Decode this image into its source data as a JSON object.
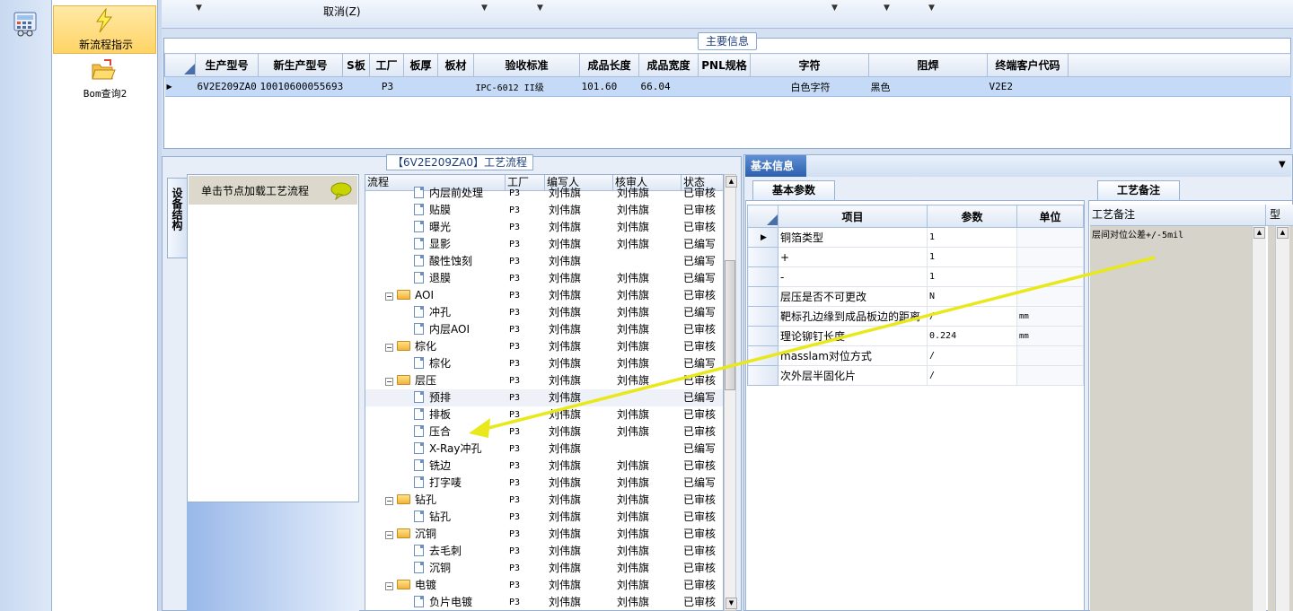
{
  "toolbar": {
    "cancel_label": "取消(Z)"
  },
  "nav": {
    "items": [
      {
        "label": "新流程指示",
        "icon": "lightning-icon"
      },
      {
        "label": "Bom查询2",
        "icon": "folder-open-icon"
      }
    ]
  },
  "main_info": {
    "title": "主要信息",
    "columns": [
      "生产型号",
      "新生产型号",
      "S板",
      "工厂",
      "板厚",
      "板材",
      "验收标准",
      "成品长度",
      "成品宽度",
      "PNL规格",
      "字符",
      "阻焊",
      "终端客户代码"
    ],
    "row": [
      "6V2E209ZA0",
      "10010600055693",
      "",
      "P3",
      "",
      "",
      "IPC-6012 II级",
      "101.60",
      "66.04",
      "",
      "白色字符",
      "黑色",
      "V2E2"
    ]
  },
  "process": {
    "title": "【6V2E209ZA0】工艺流程",
    "side_tab": "设备结构",
    "left_header": "单击节点加载工艺流程",
    "columns": [
      "流程",
      "工厂",
      "编写人",
      "核审人",
      "状态"
    ],
    "rows": [
      {
        "name": "内层前处理",
        "kind": "doc",
        "factory": "P3",
        "writer": "刘伟旗",
        "reviewer": "刘伟旗",
        "status": "已审核"
      },
      {
        "name": "贴膜",
        "kind": "doc",
        "factory": "P3",
        "writer": "刘伟旗",
        "reviewer": "刘伟旗",
        "status": "已审核"
      },
      {
        "name": "曝光",
        "kind": "doc",
        "factory": "P3",
        "writer": "刘伟旗",
        "reviewer": "刘伟旗",
        "status": "已审核"
      },
      {
        "name": "显影",
        "kind": "doc",
        "factory": "P3",
        "writer": "刘伟旗",
        "reviewer": "刘伟旗",
        "status": "已编写"
      },
      {
        "name": "酸性蚀刻",
        "kind": "doc",
        "factory": "P3",
        "writer": "刘伟旗",
        "reviewer": "",
        "status": "已编写"
      },
      {
        "name": "退膜",
        "kind": "doc",
        "factory": "P3",
        "writer": "刘伟旗",
        "reviewer": "刘伟旗",
        "status": "已编写"
      },
      {
        "name": "AOI",
        "kind": "folder",
        "factory": "P3",
        "writer": "刘伟旗",
        "reviewer": "刘伟旗",
        "status": "已审核"
      },
      {
        "name": "冲孔",
        "kind": "doc",
        "factory": "P3",
        "writer": "刘伟旗",
        "reviewer": "刘伟旗",
        "status": "已编写"
      },
      {
        "name": "内层AOI",
        "kind": "doc",
        "factory": "P3",
        "writer": "刘伟旗",
        "reviewer": "刘伟旗",
        "status": "已审核"
      },
      {
        "name": "棕化",
        "kind": "folder",
        "factory": "P3",
        "writer": "刘伟旗",
        "reviewer": "刘伟旗",
        "status": "已审核"
      },
      {
        "name": "棕化",
        "kind": "doc",
        "factory": "P3",
        "writer": "刘伟旗",
        "reviewer": "刘伟旗",
        "status": "已编写"
      },
      {
        "name": "层压",
        "kind": "folder",
        "factory": "P3",
        "writer": "刘伟旗",
        "reviewer": "刘伟旗",
        "status": "已审核"
      },
      {
        "name": "预排",
        "kind": "doc",
        "factory": "P3",
        "writer": "刘伟旗",
        "reviewer": "",
        "status": "已编写"
      },
      {
        "name": "排板",
        "kind": "doc",
        "factory": "P3",
        "writer": "刘伟旗",
        "reviewer": "刘伟旗",
        "status": "已审核"
      },
      {
        "name": "压合",
        "kind": "doc",
        "factory": "P3",
        "writer": "刘伟旗",
        "reviewer": "刘伟旗",
        "status": "已审核"
      },
      {
        "name": "X-Ray冲孔",
        "kind": "doc",
        "factory": "P3",
        "writer": "刘伟旗",
        "reviewer": "",
        "status": "已编写"
      },
      {
        "name": "铣边",
        "kind": "doc",
        "factory": "P3",
        "writer": "刘伟旗",
        "reviewer": "刘伟旗",
        "status": "已审核"
      },
      {
        "name": "打字唛",
        "kind": "doc",
        "factory": "P3",
        "writer": "刘伟旗",
        "reviewer": "刘伟旗",
        "status": "已编写"
      },
      {
        "name": "钻孔",
        "kind": "folder",
        "factory": "P3",
        "writer": "刘伟旗",
        "reviewer": "刘伟旗",
        "status": "已审核"
      },
      {
        "name": "钻孔",
        "kind": "doc",
        "factory": "P3",
        "writer": "刘伟旗",
        "reviewer": "刘伟旗",
        "status": "已审核"
      },
      {
        "name": "沉铜",
        "kind": "folder",
        "factory": "P3",
        "writer": "刘伟旗",
        "reviewer": "刘伟旗",
        "status": "已审核"
      },
      {
        "name": "去毛刺",
        "kind": "doc",
        "factory": "P3",
        "writer": "刘伟旗",
        "reviewer": "刘伟旗",
        "status": "已审核"
      },
      {
        "name": "沉铜",
        "kind": "doc",
        "factory": "P3",
        "writer": "刘伟旗",
        "reviewer": "刘伟旗",
        "status": "已审核"
      },
      {
        "name": "电镀",
        "kind": "folder",
        "factory": "P3",
        "writer": "刘伟旗",
        "reviewer": "刘伟旗",
        "status": "已审核"
      },
      {
        "name": "负片电镀",
        "kind": "doc",
        "factory": "P3",
        "writer": "刘伟旗",
        "reviewer": "刘伟旗",
        "status": "已审核"
      }
    ]
  },
  "basic_info": {
    "tab": "基本信息",
    "params_tab": "基本参数",
    "columns": [
      "项目",
      "参数",
      "单位"
    ],
    "rows": [
      {
        "item": "铜箔类型",
        "value": "1",
        "unit": ""
      },
      {
        "item": "+",
        "value": "1",
        "unit": ""
      },
      {
        "item": "-",
        "value": "1",
        "unit": ""
      },
      {
        "item": "层压是否不可更改",
        "value": "N",
        "unit": ""
      },
      {
        "item": "靶标孔边缘到成品板边的距离",
        "value": "/",
        "unit": "mm"
      },
      {
        "item": "理论铆钉长度",
        "value": "0.224",
        "unit": "mm"
      },
      {
        "item": "masslam对位方式",
        "value": "/",
        "unit": ""
      },
      {
        "item": "次外层半固化片",
        "value": "/",
        "unit": ""
      }
    ]
  },
  "remarks": {
    "tab": "工艺备注",
    "columns": [
      "工艺备注",
      "型"
    ],
    "text": "层间对位公差+/-5mil"
  },
  "colors": {
    "accent": "#2c5fae",
    "highlight": "#ffd465",
    "annotation_arrow": "#f2f21a"
  }
}
